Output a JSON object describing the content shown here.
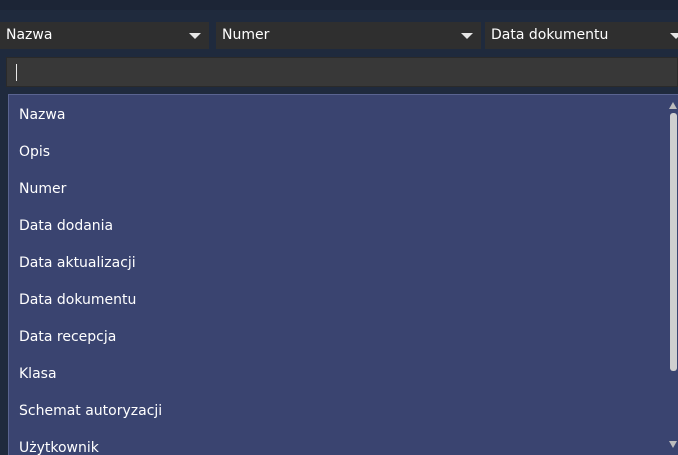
{
  "filters": {
    "field1": "Nazwa",
    "field2": "Numer",
    "field3": "Data dokumentu"
  },
  "search": {
    "value": ""
  },
  "dropdown": {
    "options": [
      "Nazwa",
      "Opis",
      "Numer",
      "Data dodania",
      "Data aktualizacji",
      "Data dokumentu",
      "Data recepcja",
      "Klasa",
      "Schemat autoryzacji",
      "Użytkownik"
    ]
  },
  "icons": {
    "dropdown_arrow": "chevron-down-icon",
    "scroll_up": "scroll-up-icon",
    "scroll_down": "scroll-down-icon"
  }
}
